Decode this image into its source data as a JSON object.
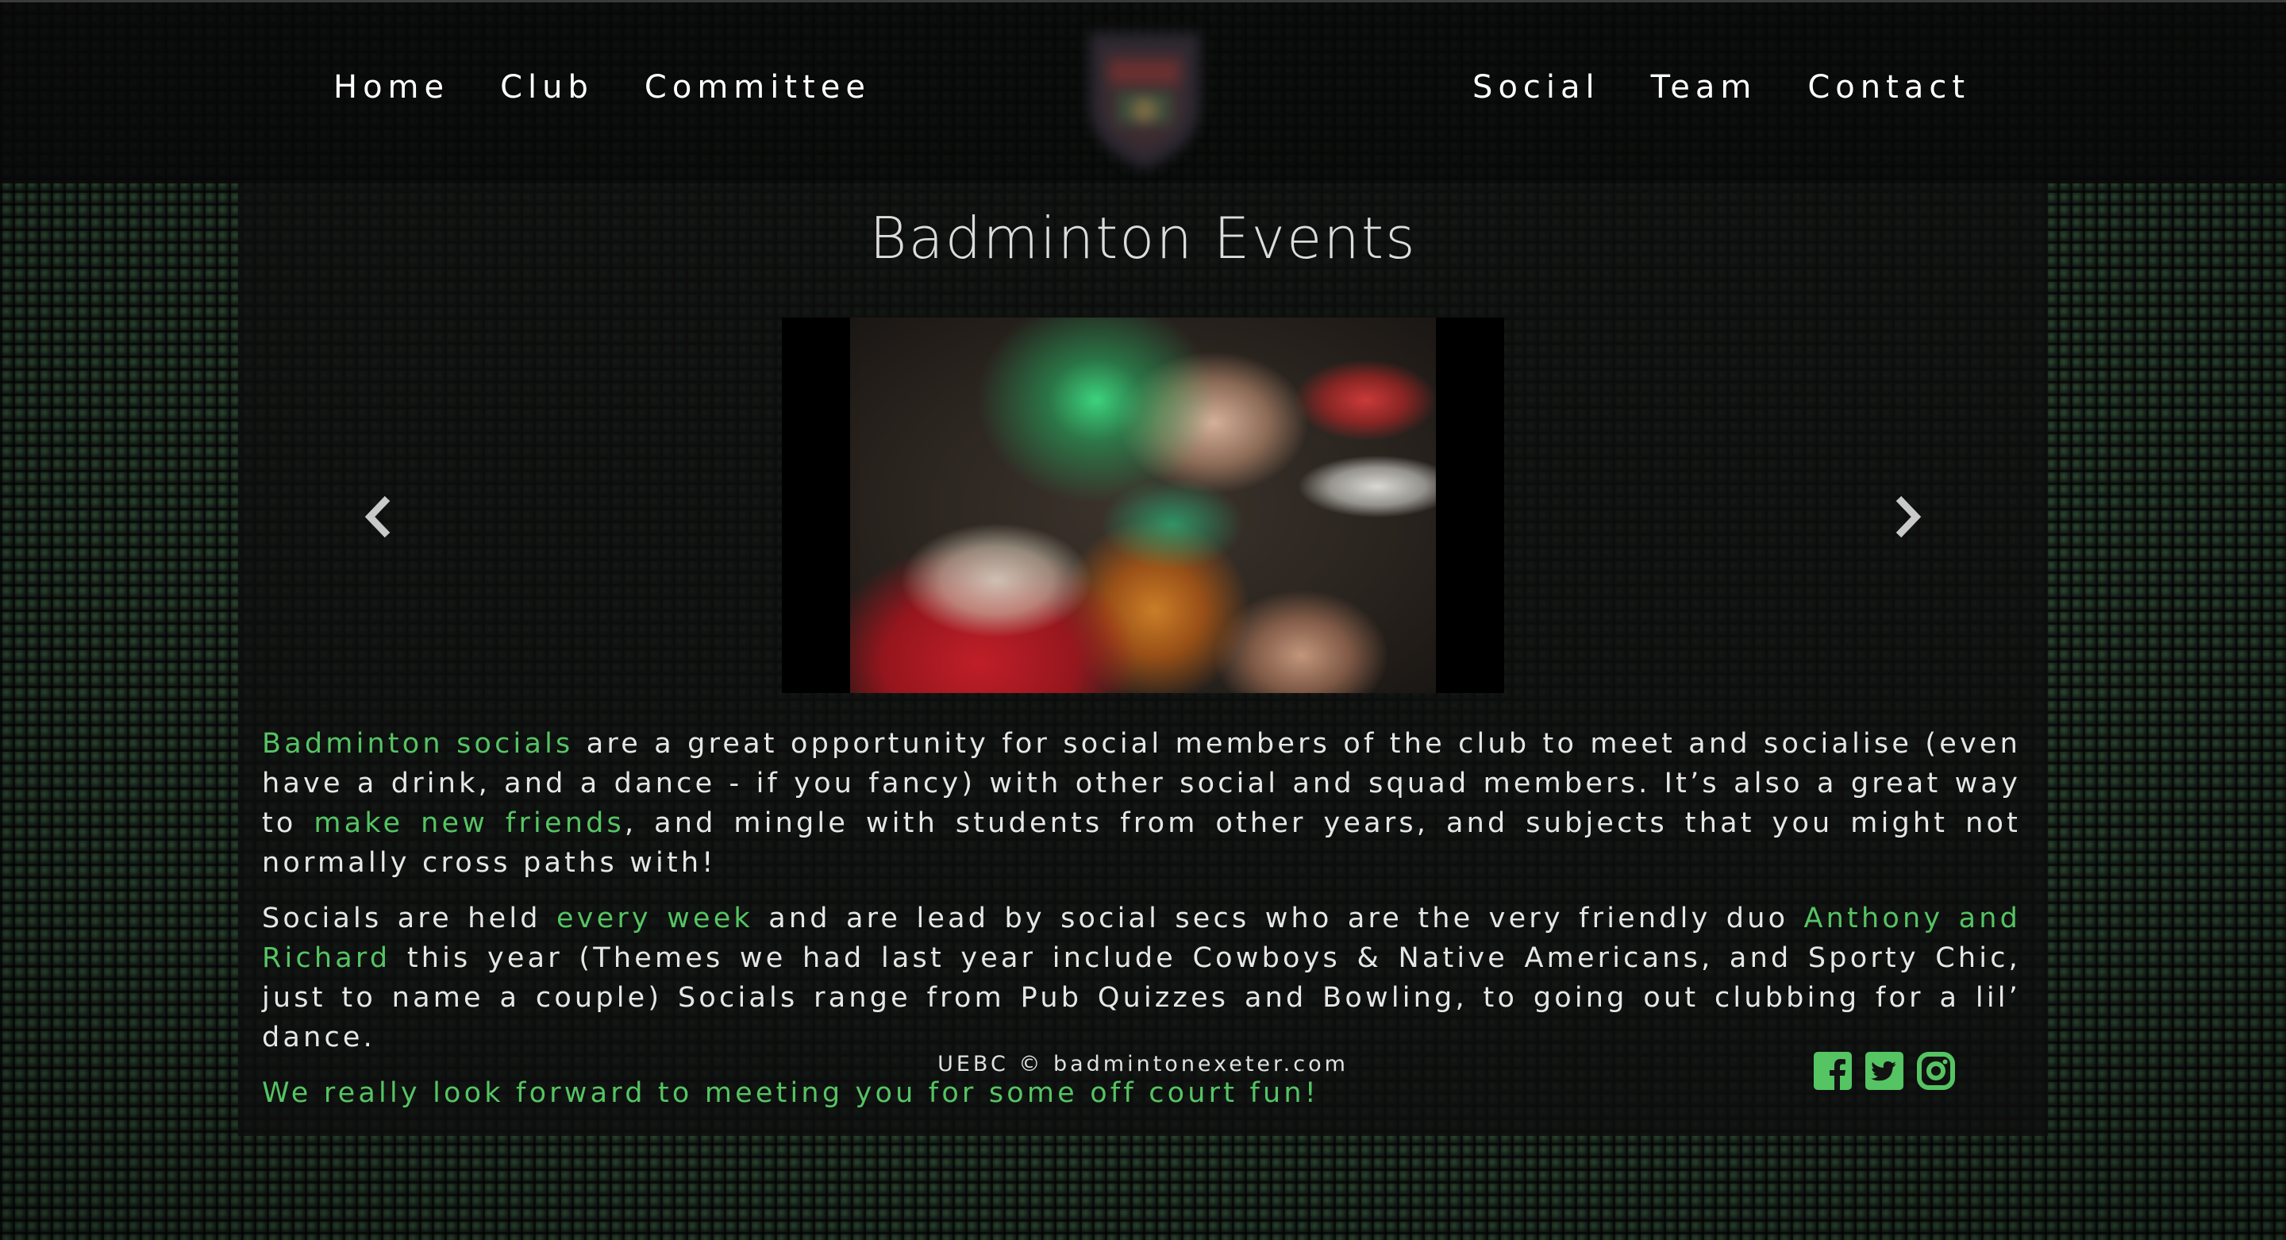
{
  "nav": {
    "left": [
      "Home",
      "Club",
      "Committee"
    ],
    "right": [
      "Social",
      "Team",
      "Contact"
    ]
  },
  "page": {
    "title": "Badminton Events"
  },
  "carousel": {
    "photo_alt": "group christmas social photo"
  },
  "content": {
    "p1": {
      "hl1": "Badminton socials",
      "t1": " are a great opportunity for social members of the club to meet and socialise (even have a drink, and a dance - if you fancy) with other social and squad members. It’s also a great way to ",
      "hl2": "make new friends",
      "t2": ", and mingle with students from other years, and subjects that you might not normally cross paths with!"
    },
    "p2": {
      "t1": "Socials are held ",
      "hl1": "every week",
      "t2": " and are lead by social secs who are the very friendly duo ",
      "hl2": "Anthony and Richard",
      "t3": " this year (Themes we had last year include Cowboys & Native Americans, and Sporty Chic, just to name a couple) Socials range from Pub Quizzes and Bowling, to going out clubbing for a lil’ dance."
    },
    "closing": "We really look forward to meeting you for some off court fun!"
  },
  "footer": {
    "text": "UEBC © badmintonexeter.com",
    "social_icons": [
      "facebook-icon",
      "twitter-icon",
      "instagram-icon"
    ]
  },
  "colors": {
    "accent": "#55c463",
    "navbar_bg": "#080808",
    "text": "#e6e6e6"
  }
}
